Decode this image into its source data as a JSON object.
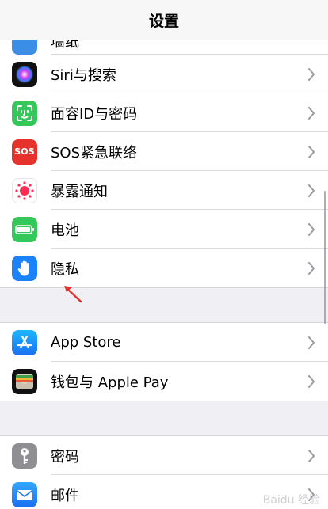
{
  "nav": {
    "title": "设置"
  },
  "partial_row": {
    "label": "墙纸",
    "icon": "wallpaper-icon"
  },
  "group1": [
    {
      "id": "siri",
      "label": "Siri与搜索",
      "icon": "siri-icon"
    },
    {
      "id": "faceid",
      "label": "面容ID与密码",
      "icon": "faceid-icon"
    },
    {
      "id": "sos",
      "label": "SOS紧急联络",
      "icon": "sos-icon",
      "icon_text": "SOS"
    },
    {
      "id": "exposure",
      "label": "暴露通知",
      "icon": "exposure-notification-icon"
    },
    {
      "id": "battery",
      "label": "电池",
      "icon": "battery-icon"
    },
    {
      "id": "privacy",
      "label": "隐私",
      "icon": "privacy-hand-icon"
    }
  ],
  "group2": [
    {
      "id": "appstore",
      "label": "App Store",
      "icon": "app-store-icon"
    },
    {
      "id": "wallet",
      "label": "钱包与 Apple Pay",
      "icon": "wallet-icon"
    }
  ],
  "group3": [
    {
      "id": "passwords",
      "label": "密码",
      "icon": "key-icon"
    },
    {
      "id": "mail",
      "label": "邮件",
      "icon": "mail-icon"
    }
  ],
  "colors": {
    "accent_red_arrow": "#e5322d",
    "sos": "#e5322d",
    "faceid": "#34c759",
    "battery": "#34c759",
    "privacy": "#1a82fb",
    "appstore": "#1a8cff",
    "mail": "#1e88f5",
    "passwords": "#8e8e93"
  },
  "watermark": "Baidu 经验"
}
